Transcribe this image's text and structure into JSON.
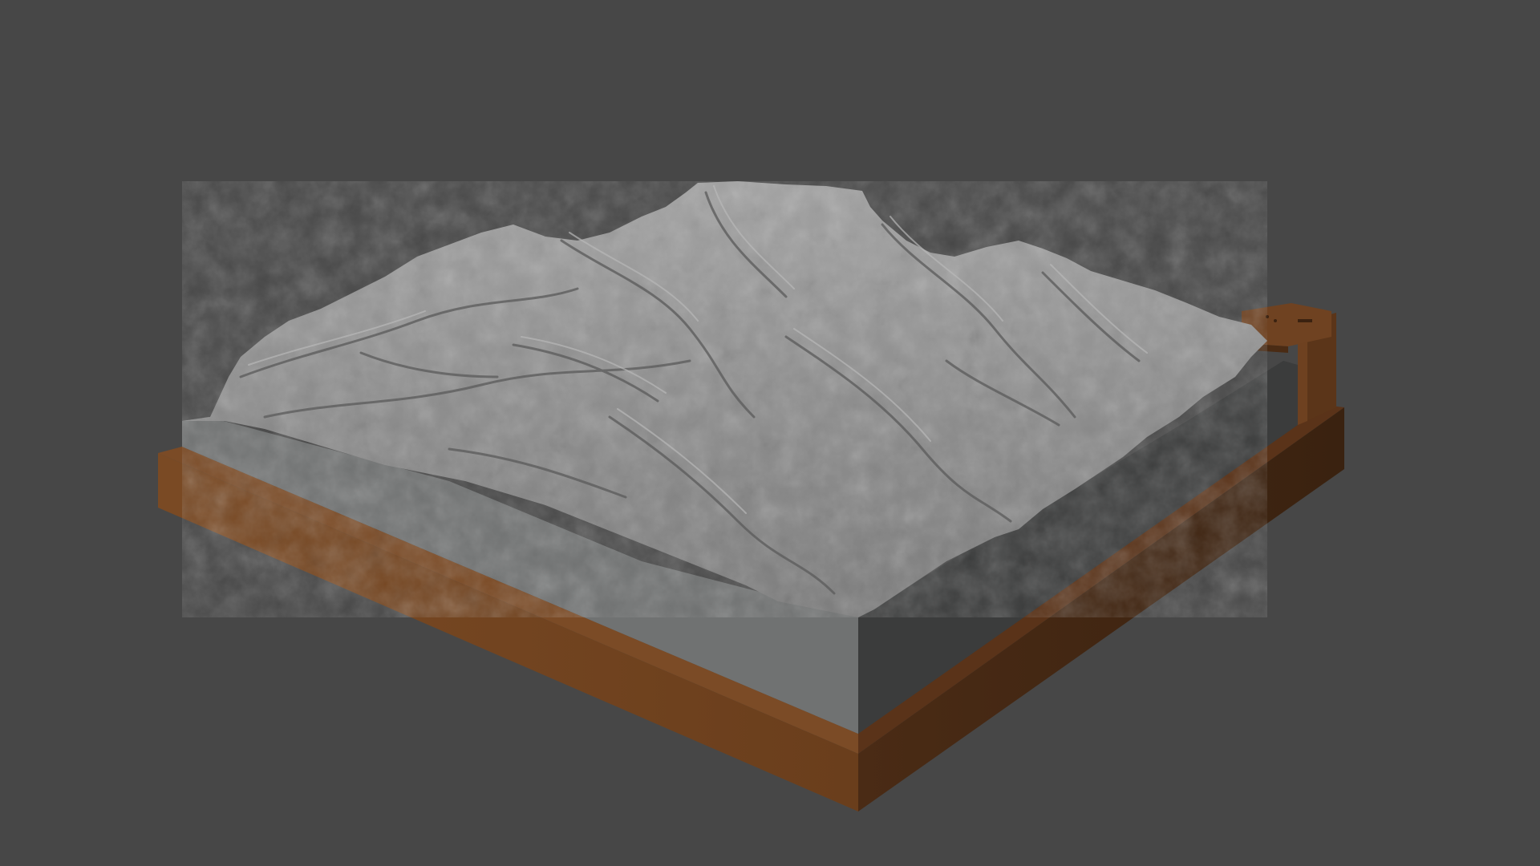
{
  "viewport": {
    "background_color": "#474747"
  },
  "model": {
    "subject": "terrain-relief-model",
    "terrain_color": "#8f8f8f",
    "terrain_side_color": "#6b6d6d",
    "terrain_back_color": "#3a3b3b",
    "frame_color": "#73441f",
    "frame_shadow_color": "#3e2414",
    "has_label_plate": true
  }
}
